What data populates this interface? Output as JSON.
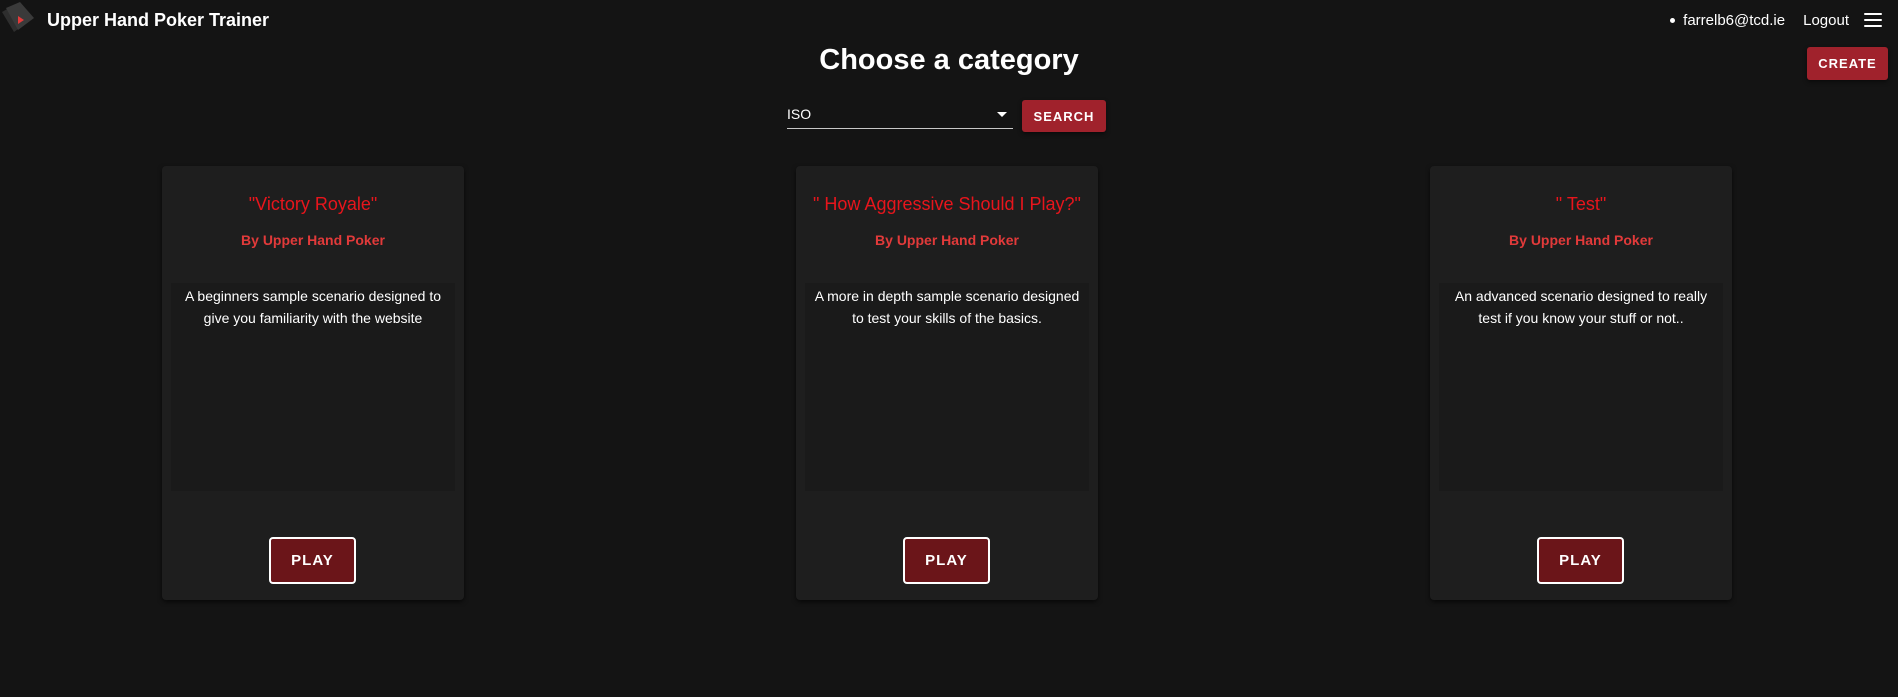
{
  "header": {
    "app_title": "Upper Hand Poker Trainer",
    "user_email": "farrelb6@tcd.ie",
    "logout_label": "Logout",
    "create_label": "CREATE"
  },
  "main": {
    "page_title": "Choose a category",
    "category_select": {
      "selected": "ISO"
    },
    "search_label": "SEARCH"
  },
  "cards": [
    {
      "title": "\"Victory Royale\"",
      "author": "By Upper Hand Poker",
      "description": "A beginners sample scenario designed to give you familiarity with the website",
      "play_label": "PLAY"
    },
    {
      "title": "\" How Aggressive Should I Play?\"",
      "author": "By Upper Hand Poker",
      "description": "A more in depth sample scenario designed to test your skills of the basics.",
      "play_label": "PLAY"
    },
    {
      "title": "\" Test\"",
      "author": "By Upper Hand Poker",
      "description": "An advanced scenario designed to really test if you know your stuff or not..",
      "play_label": "PLAY"
    }
  ],
  "icons": {
    "logo": "poker-card-logo-icon",
    "user_status": "online-dot-icon",
    "menu": "hamburger-menu-icon",
    "dropdown": "chevron-down-icon"
  },
  "colors": {
    "background": "#141414",
    "card_background": "#1e1e1e",
    "accent_button": "#a0222c",
    "play_button": "#6b1519",
    "card_title": "#e8151c",
    "card_author": "#e23a3a"
  }
}
